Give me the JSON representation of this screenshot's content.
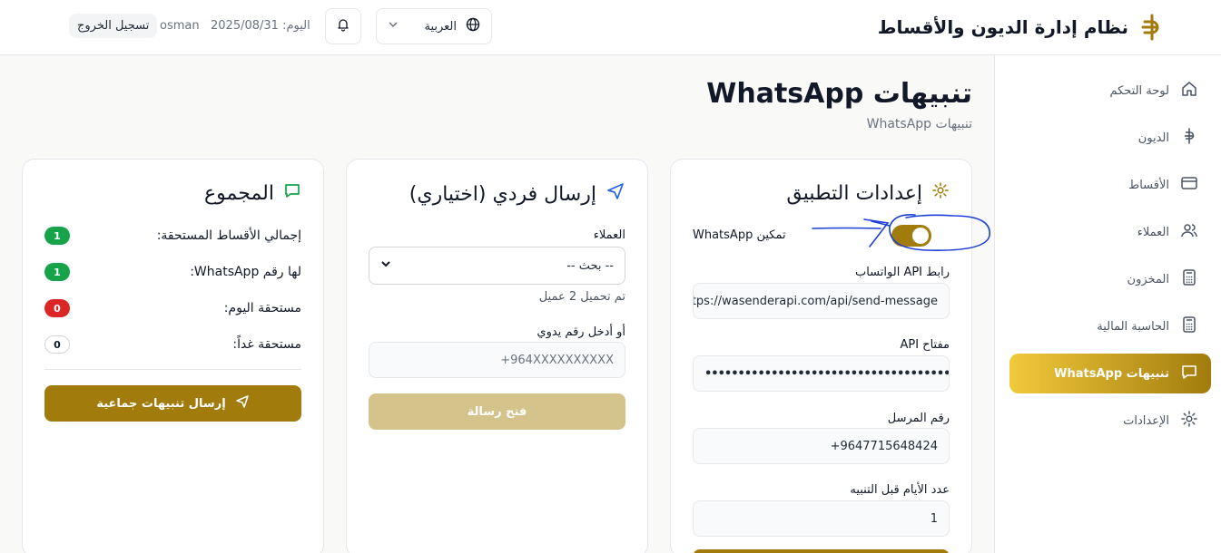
{
  "header": {
    "app_title": "نظام إدارة الديون والأقساط",
    "language": "العربية",
    "today": "اليوم: 2025/08/31",
    "username": "osman",
    "logout": "تسجيل الخروج"
  },
  "sidebar": {
    "items": [
      {
        "label": "لوحة التحكم",
        "icon": "home-icon"
      },
      {
        "label": "الديون",
        "icon": "currency-icon"
      },
      {
        "label": "الأقساط",
        "icon": "credit-card-icon"
      },
      {
        "label": "العملاء",
        "icon": "users-icon"
      },
      {
        "label": "المخزون",
        "icon": "calculator-icon"
      },
      {
        "label": "الحاسبة المالية",
        "icon": "calculator-icon"
      },
      {
        "label": "تنبيهات WhatsApp",
        "icon": "message-icon",
        "active": true
      },
      {
        "label": "الإعدادات",
        "icon": "gear-icon"
      }
    ]
  },
  "page": {
    "title": "تنبيهات WhatsApp",
    "subtitle": "تنبيهات WhatsApp"
  },
  "settings_card": {
    "title": "إعدادات التطبيق",
    "enable_label": "تمكين WhatsApp",
    "enabled": true,
    "api_url_label": "رابط API الواتساب",
    "api_url_value": "https://wasenderapi.com/api/send-message",
    "api_key_label": "مفتاح API",
    "api_key_value": "••••••••••••••••••••••••••••••••••••••••••",
    "sender_label": "رقم المرسل",
    "sender_value": "+9647715648424",
    "days_label": "عدد الأيام قبل التنبيه",
    "days_value": "1"
  },
  "single_card": {
    "title": "إرسال فردي (اختياري)",
    "customers_label": "العملاء",
    "select_value": "-- بحث --",
    "loaded_text": "تم تحميل 2 عميل",
    "manual_label": "أو أدخل رقم يدوي",
    "manual_placeholder": "+964XXXXXXXXXX",
    "open_button": "فتح رسالة"
  },
  "summary_card": {
    "title": "المجموع",
    "stats": [
      {
        "label": "إجمالي الأقساط المستحقة:",
        "value": "1",
        "color": "green"
      },
      {
        "label": "لها رقم WhatsApp:",
        "value": "1",
        "color": "green"
      },
      {
        "label": "مستحقة اليوم:",
        "value": "0",
        "color": "red"
      },
      {
        "label": "مستحقة غداً:",
        "value": "0",
        "color": "outline"
      }
    ],
    "bulk_button": "إرسال تنبيهات جماعية"
  },
  "colors": {
    "accent": "#a17c0d",
    "accent_light": "#f1c93b",
    "muted_button": "#d4c38a",
    "annotation_ink": "#1d3fd6"
  }
}
